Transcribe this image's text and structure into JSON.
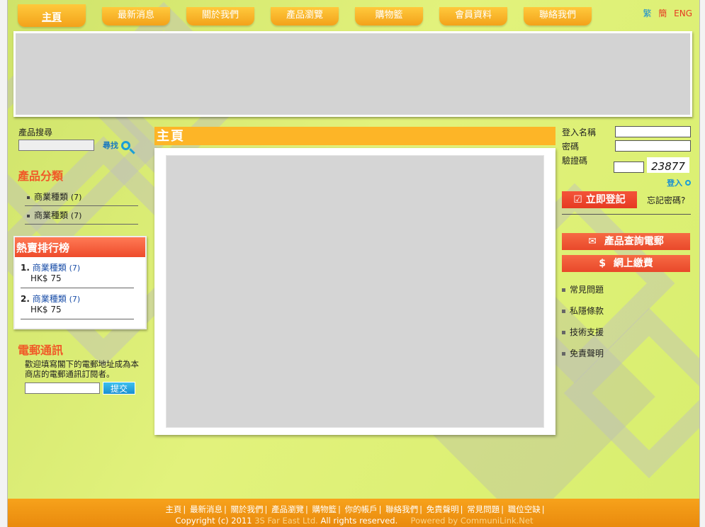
{
  "nav": {
    "tabs": [
      "主頁",
      "最新消息",
      "關於我們",
      "產品瀏覽",
      "購物籃",
      "會員資料",
      "聯絡我們"
    ],
    "active": "主頁"
  },
  "lang": [
    "繁",
    "簡",
    "ENG"
  ],
  "left": {
    "search_label": "產品搜尋",
    "search_button": "尋找",
    "categories_title": "產品分類",
    "categories": [
      {
        "name": "商業種類",
        "count": "(7)"
      },
      {
        "name": "商業種類",
        "count": "(7)"
      }
    ],
    "hot_title": "熱賣排行榜",
    "hot_items": [
      {
        "rank": "1.",
        "name": "商業種類",
        "count": "(7)",
        "price": "HK$ 75"
      },
      {
        "rank": "2.",
        "name": "商業種類",
        "count": "(7)",
        "price": "HK$ 75"
      }
    ],
    "newsletter_title": "電郵通訊",
    "newsletter_text": "歡迎填寫閣下的電郵地址成為本商店的電郵通訊訂閱者。",
    "newsletter_button": "提交"
  },
  "main": {
    "title": "主頁"
  },
  "right": {
    "username_label": "登入名稱",
    "password_label": "密碼",
    "captcha_label": "驗證碼",
    "captcha_code": "23877",
    "login_label": "登入",
    "register_button": "立即登記",
    "forgot_label": "忘記密碼?",
    "enquiry_button": "產品查詢電郵",
    "payment_button": "網上繳費",
    "links": [
      "常見問題",
      "私隱條款",
      "技術支援",
      "免責聲明"
    ]
  },
  "footer": {
    "links": [
      "主頁",
      "最新消息",
      "關於我們",
      "產品瀏覽",
      "購物籃",
      "你的帳戶",
      "聯絡我們",
      "免責聲明",
      "常見問題",
      "職位空缺"
    ],
    "copyright_prefix": "Copyright (c) 2011",
    "company": "3S Far East Ltd.",
    "rights": "All rights reserved.",
    "powered": "Powered by CommuniLink.Net"
  },
  "colors": {
    "nav_orange": "#f7a21b",
    "accent_red": "#e63a22",
    "section_title": "#f05a28",
    "link_blue": "#1a4ea8"
  }
}
